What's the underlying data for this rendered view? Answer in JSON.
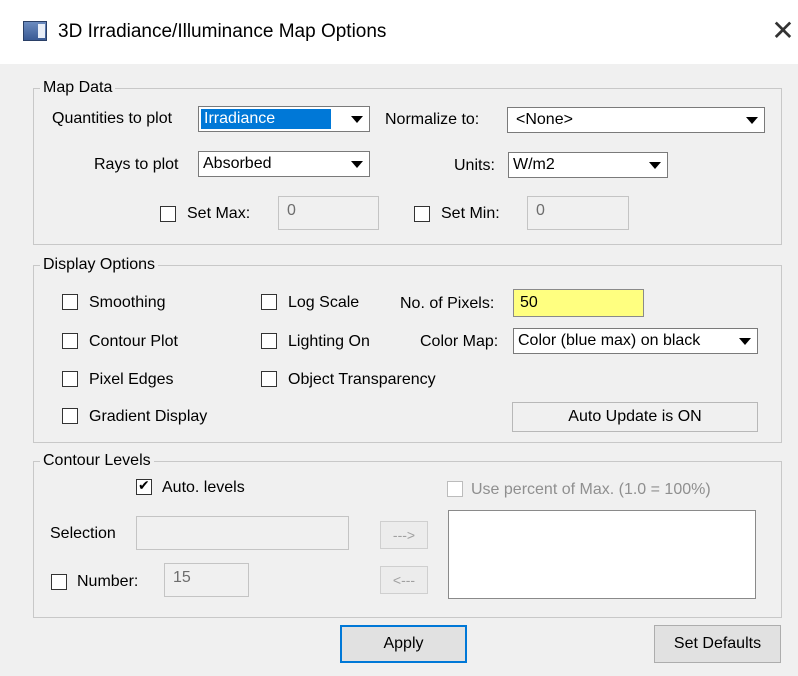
{
  "window": {
    "title": "3D Irradiance/Illuminance Map Options"
  },
  "map_data": {
    "group_title": "Map Data",
    "quantities_label": "Quantities to plot",
    "quantities_value": "Irradiance",
    "normalize_label": "Normalize to:",
    "normalize_value": "<None>",
    "rays_label": "Rays to plot",
    "rays_value": "Absorbed",
    "units_label": "Units:",
    "units_value": "W/m2",
    "set_max_label": "Set Max:",
    "set_max_checked": false,
    "set_max_value": "0",
    "set_min_label": "Set Min:",
    "set_min_checked": false,
    "set_min_value": "0"
  },
  "display_options": {
    "group_title": "Display Options",
    "smoothing_label": "Smoothing",
    "contour_plot_label": "Contour Plot",
    "pixel_edges_label": "Pixel Edges",
    "gradient_display_label": "Gradient Display",
    "log_scale_label": "Log Scale",
    "lighting_on_label": "Lighting On",
    "object_transparency_label": "Object Transparency",
    "pixels_label": "No. of Pixels:",
    "pixels_value": "50",
    "color_map_label": "Color Map:",
    "color_map_value": "Color (blue max) on black",
    "auto_update_status": "Auto Update is ON"
  },
  "contour_levels": {
    "group_title": "Contour Levels",
    "auto_levels_label": "Auto. levels",
    "auto_levels_checked": true,
    "use_percent_label": "Use percent of Max. (1.0 = 100%)",
    "selection_label": "Selection",
    "selection_value": "",
    "add_button": "--->",
    "remove_button": "<---",
    "number_label": "Number:",
    "number_checked": false,
    "number_value": "15"
  },
  "buttons": {
    "apply": "Apply",
    "set_defaults": "Set Defaults"
  }
}
